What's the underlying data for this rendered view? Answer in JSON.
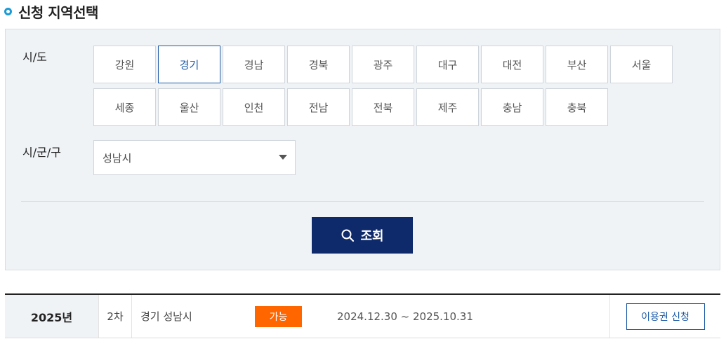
{
  "section": {
    "title": "신청 지역선택"
  },
  "filter": {
    "sido_label": "시/도",
    "sigungu_label": "시/군/구",
    "regions": [
      "강원",
      "경기",
      "경남",
      "경북",
      "광주",
      "대구",
      "대전",
      "부산",
      "서울",
      "세종",
      "울산",
      "인천",
      "전남",
      "전북",
      "제주",
      "충남",
      "충북"
    ],
    "selected_region": "경기",
    "sigungu_value": "성남시",
    "search_label": "조회"
  },
  "result": {
    "year": "2025년",
    "round": "2차",
    "region": "경기 성남시",
    "status": "가능",
    "period": "2024.12.30 ~ 2025.10.31",
    "action_label": "이용권 신청"
  },
  "colors": {
    "accent": "#1c5aa6",
    "primary_button": "#0e2a6b",
    "status_badge": "#ff6600",
    "title_dot": "#1a9bd7"
  }
}
